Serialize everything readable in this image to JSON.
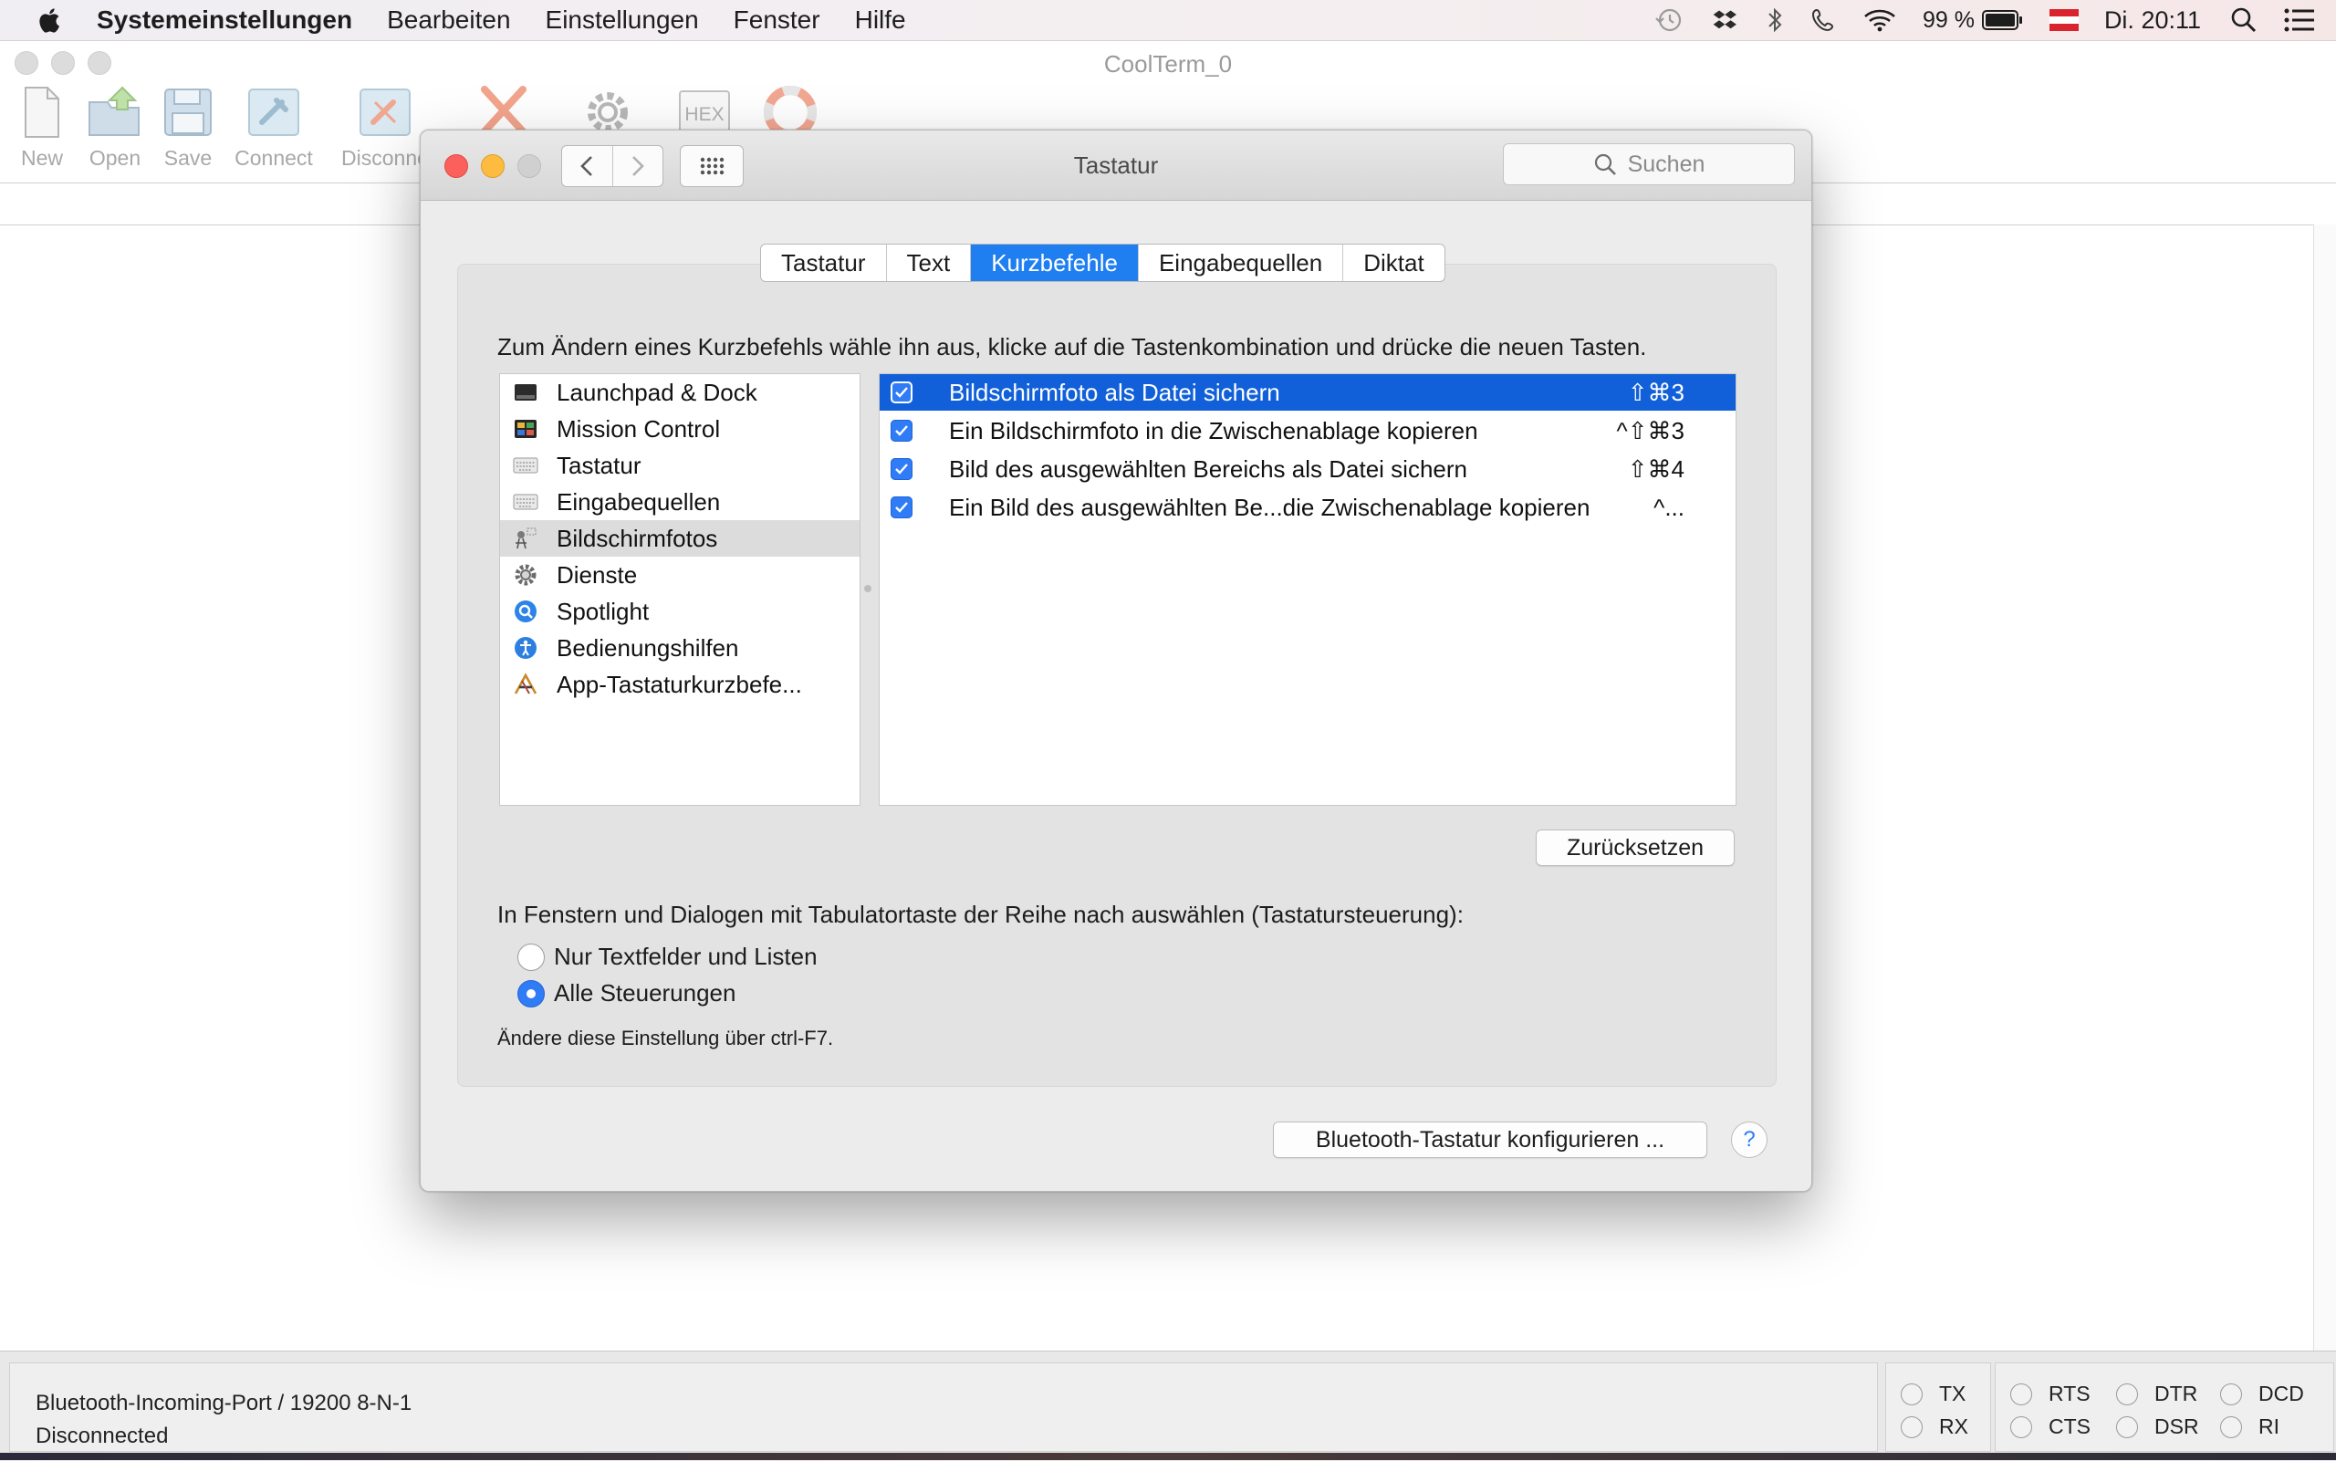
{
  "menubar": {
    "app_name": "Systemeinstellungen",
    "items": [
      "Bearbeiten",
      "Einstellungen",
      "Fenster",
      "Hilfe"
    ],
    "battery": "99 %",
    "clock": "Di. 20:11"
  },
  "coolterm": {
    "title": "CoolTerm_0",
    "toolbar": [
      "New",
      "Open",
      "Save",
      "Connect",
      "Disconne"
    ],
    "hex_label": "HEX",
    "port": "Bluetooth-Incoming-Port / 19200 8-N-1",
    "status": "Disconnected",
    "leds": [
      "TX",
      "RX",
      "RTS",
      "CTS",
      "DTR",
      "DSR",
      "DCD",
      "RI"
    ]
  },
  "window": {
    "title": "Tastatur",
    "search_placeholder": "Suchen",
    "tabs": [
      "Tastatur",
      "Text",
      "Kurzbefehle",
      "Eingabequellen",
      "Diktat"
    ],
    "active_tab": "Kurzbefehle",
    "instruction": "Zum Ändern eines Kurzbefehls wähle ihn aus, klicke auf die Tastenkombination und drücke die neuen Tasten.",
    "categories": [
      {
        "label": "Launchpad & Dock",
        "icon": "launchpad-icon"
      },
      {
        "label": "Mission Control",
        "icon": "mission-control-icon"
      },
      {
        "label": "Tastatur",
        "icon": "keyboard-icon"
      },
      {
        "label": "Eingabequellen",
        "icon": "keyboard-icon"
      },
      {
        "label": "Bildschirmfotos",
        "icon": "screenshot-icon"
      },
      {
        "label": "Dienste",
        "icon": "gear-icon"
      },
      {
        "label": "Spotlight",
        "icon": "spotlight-icon"
      },
      {
        "label": "Bedienungshilfen",
        "icon": "accessibility-icon"
      },
      {
        "label": "App-Tastaturkurzbefe...",
        "icon": "app-store-icon"
      }
    ],
    "selected_category": "Bildschirmfotos",
    "shortcuts": [
      {
        "label": "Bildschirmfoto als Datei sichern",
        "keys": "⇧⌘3",
        "checked": true
      },
      {
        "label": "Ein Bildschirmfoto in die Zwischenablage kopieren",
        "keys": "^⇧⌘3",
        "checked": true
      },
      {
        "label": "Bild des ausgewählten Bereichs als Datei sichern",
        "keys": "⇧⌘4",
        "checked": true
      },
      {
        "label": "Ein Bild des ausgewählten Be...die Zwischenablage kopieren",
        "keys": "^...",
        "checked": true
      }
    ],
    "reset_button": "Zurücksetzen",
    "tab_navigation_label": "In Fenstern und Dialogen mit Tabulatortaste der Reihe nach auswählen (Tastatursteuerung):",
    "radio_options": [
      "Nur Textfelder und Listen",
      "Alle Steuerungen"
    ],
    "radio_selected": "Alle Steuerungen",
    "hint": "Ändere diese Einstellung über ctrl-F7.",
    "bluetooth_button": "Bluetooth-Tastatur konfigurieren ...",
    "help_label": "?"
  },
  "colors": {
    "accent": "#1f7ff0",
    "selection": "#1160d9",
    "close": "#fc605c",
    "minimize": "#fdbc40"
  }
}
